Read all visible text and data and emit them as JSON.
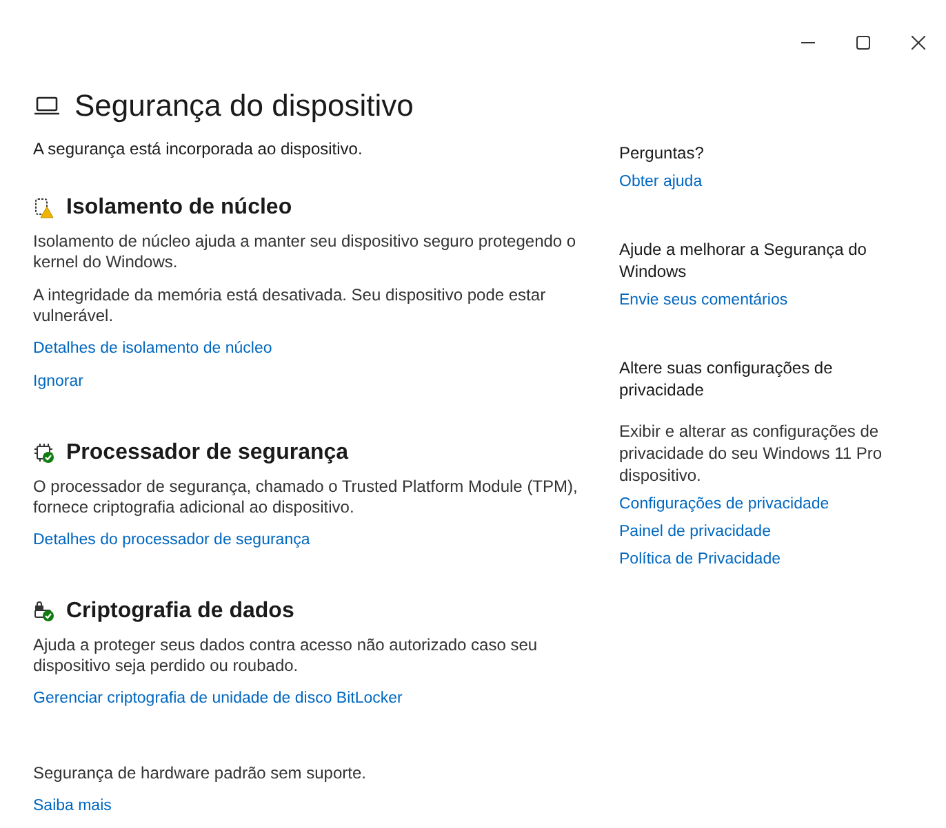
{
  "window": {
    "controls": [
      {
        "kind": "minimize"
      },
      {
        "kind": "maximize"
      },
      {
        "kind": "close"
      }
    ]
  },
  "page": {
    "title": "Segurança do dispositivo",
    "subtitle": "A segurança está incorporada ao dispositivo."
  },
  "sections": [
    {
      "kind": "core",
      "ok": false,
      "title": "Isolamento de núcleo",
      "paragraphs": [
        "Isolamento de núcleo ajuda a manter seu dispositivo seguro protegendo o kernel do Windows.",
        "A integridade da memória está desativada. Seu dispositivo pode estar vulnerável."
      ],
      "links": [
        "Detalhes de isolamento de núcleo",
        "Ignorar"
      ]
    },
    {
      "kind": "chip",
      "ok": true,
      "title": "Processador de segurança",
      "paragraphs": [
        "O processador de segurança, chamado o Trusted Platform Module (TPM), fornece criptografia adicional ao dispositivo."
      ],
      "links": [
        "Detalhes do processador de segurança"
      ]
    },
    {
      "kind": "drive",
      "ok": true,
      "title": "Criptografia de dados",
      "paragraphs": [
        "Ajuda a proteger seus dados contra acesso não autorizado caso seu dispositivo seja perdido ou roubado."
      ],
      "links": [
        "Gerenciar criptografia de unidade de disco BitLocker"
      ]
    }
  ],
  "footer": {
    "text": "Segurança de hardware padrão sem suporte.",
    "link": "Saiba mais"
  },
  "sidebar": [
    {
      "heading": "Perguntas?",
      "links": [
        "Obter ajuda"
      ]
    },
    {
      "heading": "Ajude a melhorar a Segurança do Windows",
      "links": [
        "Envie seus comentários"
      ]
    },
    {
      "heading": "Altere suas configurações de privacidade",
      "text": "Exibir e alterar as configurações de privacidade do seu Windows 11 Pro dispositivo.",
      "links": [
        "Configurações de privacidade",
        "Painel de privacidade",
        "Política de Privacidade"
      ]
    }
  ]
}
